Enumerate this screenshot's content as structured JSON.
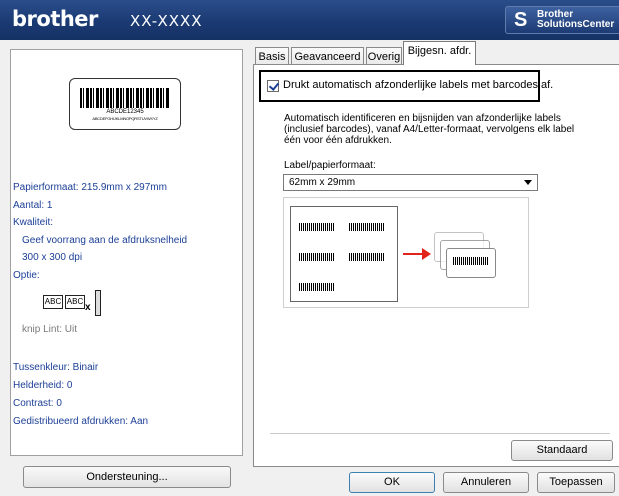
{
  "header": {
    "brand": "brother",
    "model": "XX-XXXX",
    "solutions_center": {
      "line1": "Brother",
      "line2": "SolutionsCenter"
    }
  },
  "left_panel": {
    "label_preview": {
      "barcode_number": "ABCDE12345",
      "barcode_text": "ABCDEFGHIJKLMNOPQRSTUVWXYZ"
    },
    "paper_format": "Papierformaat: 215.9mm x 297mm",
    "count": "Aantal: 1",
    "quality_label": "Kwaliteit:",
    "quality_value": "Geef voorrang aan de afdruksnelheid",
    "resolution": "300 x 300 dpi",
    "option_label": "Optie:",
    "cut_abc_1": "ABC",
    "cut_abc_2": "ABC",
    "cut_x": "x",
    "cut_line": "knip Lint: Uit",
    "halftone": "Tussenkleur: Binair",
    "brightness": "Helderheid:  0",
    "contrast": "Contrast:  0",
    "distributed": "Gedistribueerd afdrukken: Aan",
    "support_button": "Ondersteuning..."
  },
  "tabs": [
    {
      "label": "Basis",
      "active": false
    },
    {
      "label": "Geavanceerd",
      "active": false
    },
    {
      "label": "Overig",
      "active": false
    },
    {
      "label": "Bijgesn. afdr.",
      "active": true
    }
  ],
  "main": {
    "checkbox_label": "Drukt automatisch afzonderlijke labels met barcodes af.",
    "checkbox_checked": true,
    "description": "Automatisch identificeren en bijsnijden van afzonderlijke labels (inclusief barcodes), vanaf A4/Letter-formaat, vervolgens elk label één voor één afdrukken.",
    "size_label": "Label/papierformaat:",
    "size_value": "62mm x 29mm",
    "standard_button": "Standaard"
  },
  "footer": {
    "ok": "OK",
    "cancel": "Annuleren",
    "apply": "Toepassen"
  },
  "colors": {
    "header_bg": "#1b3a73",
    "link_blue": "#1c3f96",
    "arrow_red": "#e3231b"
  }
}
